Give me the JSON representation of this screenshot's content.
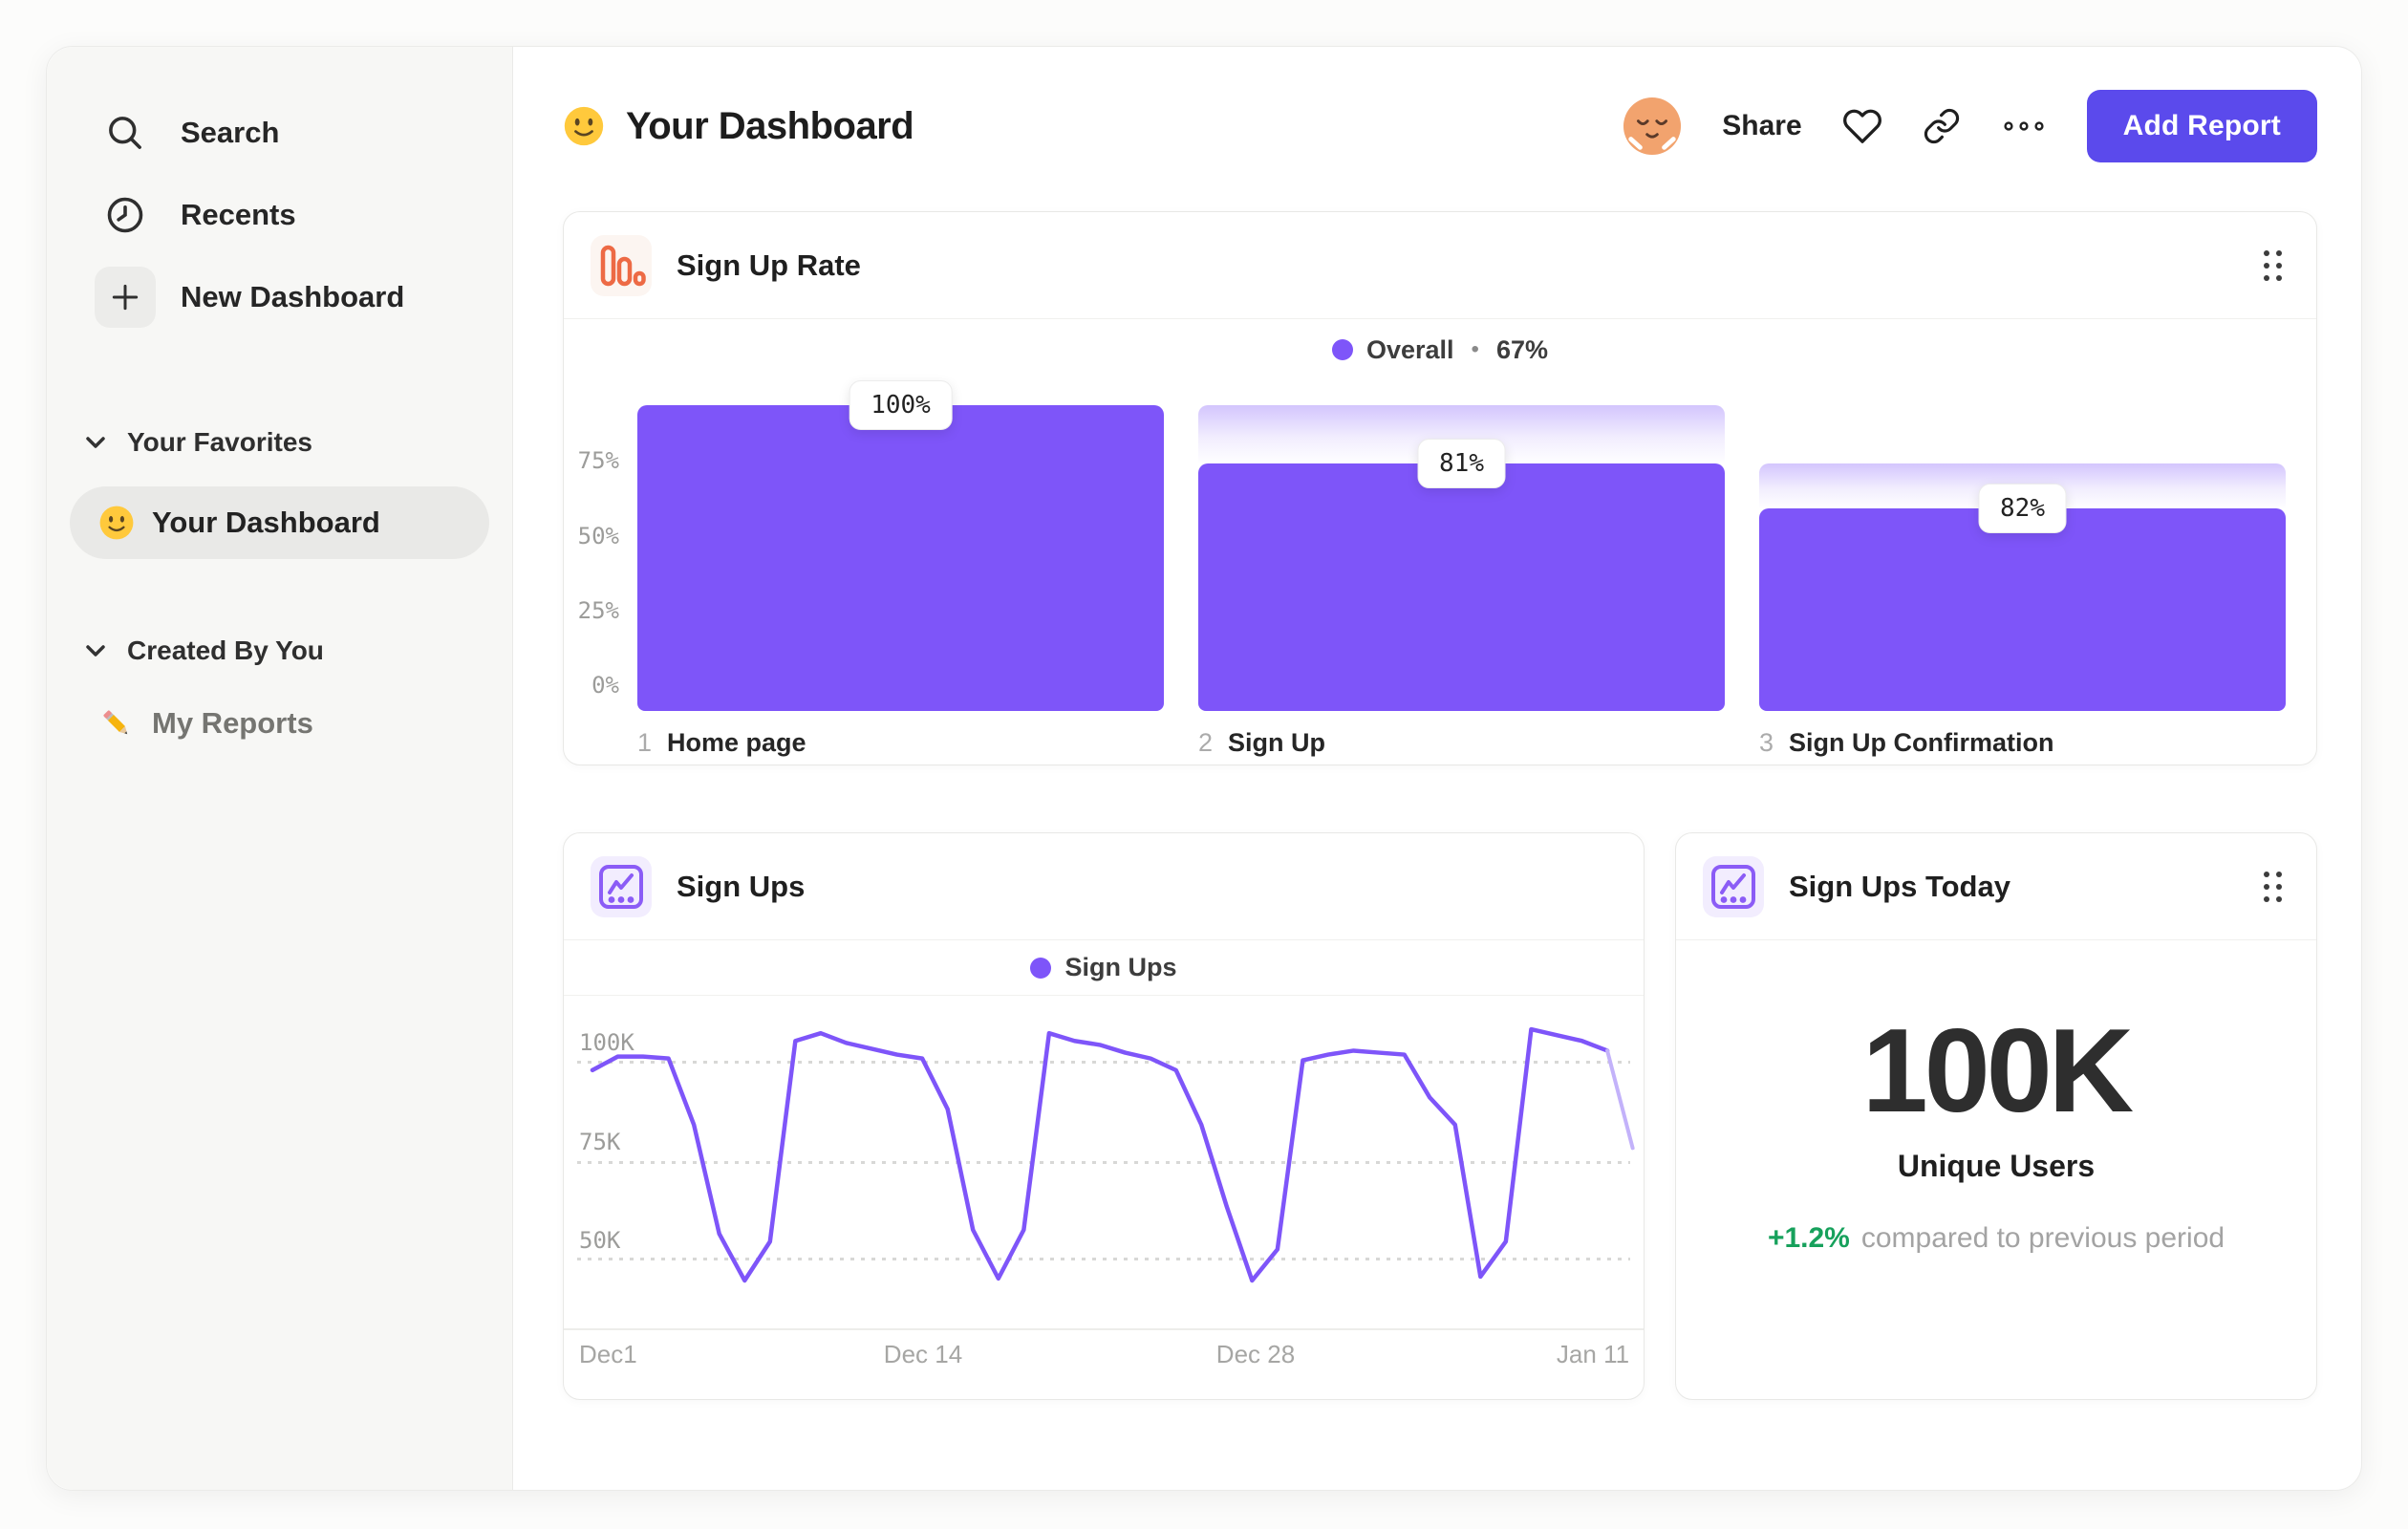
{
  "sidebar": {
    "nav": [
      {
        "icon": "search",
        "label": "Search"
      },
      {
        "icon": "clock",
        "label": "Recents"
      },
      {
        "icon": "plus",
        "label": "New Dashboard"
      }
    ],
    "sections": [
      {
        "title": "Your Favorites",
        "items": [
          {
            "emoji": "slightly-smiling-face",
            "label": "Your Dashboard",
            "selected": true
          }
        ]
      },
      {
        "title": "Created By You",
        "items": [
          {
            "emoji": "pencil",
            "label": "My Reports",
            "selected": false
          }
        ]
      }
    ]
  },
  "header": {
    "emoji": "slightly-smiling-face",
    "title": "Your Dashboard",
    "share_label": "Share",
    "add_report_label": "Add Report"
  },
  "colors": {
    "accent_purple": "#7E55F9",
    "button_indigo": "#5B4AEC",
    "icon_orange": "#ED6A45",
    "icon_purple": "#8B5CF6",
    "positive_green": "#17A15C"
  },
  "chart_data": [
    {
      "id": "sign-up-rate-funnel",
      "type": "bar",
      "title": "Sign Up Rate",
      "legend": {
        "position": "top-center",
        "entries": [
          {
            "label": "Overall",
            "separator": "•",
            "value": "67%",
            "color": "#7E55F9"
          }
        ]
      },
      "yticks": [
        "75%",
        "50%",
        "25%",
        "0%"
      ],
      "ylim": [
        0,
        100
      ],
      "grid": false,
      "steps": [
        {
          "number": "1",
          "category": "Home page",
          "conversion_from_previous_pct": 100,
          "absolute_pct": 100,
          "label": "100%"
        },
        {
          "number": "2",
          "category": "Sign Up",
          "conversion_from_previous_pct": 81,
          "absolute_pct": 81,
          "label": "81%"
        },
        {
          "number": "3",
          "category": "Sign Up Confirmation",
          "conversion_from_previous_pct": 82,
          "absolute_pct": 66.4,
          "label": "82%"
        }
      ]
    },
    {
      "id": "sign-ups-line",
      "type": "line",
      "title": "Sign Ups",
      "legend": {
        "position": "top-center",
        "entries": [
          {
            "label": "Sign Ups",
            "color": "#7E55F9"
          }
        ]
      },
      "x_tick_labels": [
        "Dec1",
        "Dec 14",
        "Dec 28",
        "Jan 11"
      ],
      "x_tick_indices": [
        0,
        13,
        27,
        41
      ],
      "x_unit": "day",
      "yticks": [
        {
          "label": "100K",
          "value": 100000
        },
        {
          "label": "75K",
          "value": 75000
        },
        {
          "label": "50K",
          "value": 50000
        }
      ],
      "grid": "dotted-horizontal",
      "incomplete_final_segment": true,
      "values_unique_users": [
        97000,
        100500,
        100500,
        100000,
        83000,
        55000,
        43000,
        53000,
        104500,
        106500,
        104000,
        102500,
        101000,
        100000,
        87000,
        56000,
        43500,
        56000,
        106500,
        104500,
        103500,
        101500,
        100000,
        97000,
        83000,
        62000,
        43000,
        51000,
        99500,
        101000,
        102000,
        101500,
        101000,
        90000,
        83000,
        44000,
        53000,
        107500,
        106000,
        104500,
        102000,
        77000
      ]
    },
    {
      "id": "sign-ups-today",
      "type": "big_number",
      "title": "Sign Ups Today",
      "value": "100K",
      "metric_label": "Unique Users",
      "delta": "+1.2%",
      "comparison_text": "compared to previous period"
    }
  ]
}
